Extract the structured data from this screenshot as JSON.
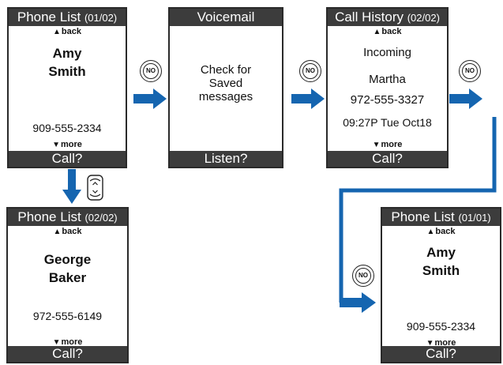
{
  "screens": {
    "phone_list_1": {
      "title": "Phone List",
      "page": "(01/02)",
      "back": "back",
      "name_first": "Amy",
      "name_last": "Smith",
      "number": "909-555-2334",
      "more": "more",
      "softkey": "Call?"
    },
    "voicemail": {
      "title": "Voicemail",
      "line1": "Check for",
      "line2": "Saved",
      "line3": "messages",
      "softkey": "Listen?"
    },
    "call_history": {
      "title": "Call History",
      "page": "(02/02)",
      "back": "back",
      "direction": "Incoming",
      "caller": "Martha",
      "number": "972-555-3327",
      "time": "09:27P Tue Oct18",
      "more": "more",
      "softkey": "Call?"
    },
    "phone_list_2": {
      "title": "Phone List",
      "page": "(02/02)",
      "back": "back",
      "name_first": "George",
      "name_last": "Baker",
      "number": "972-555-6149",
      "more": "more",
      "softkey": "Call?"
    },
    "phone_list_3": {
      "title": "Phone List",
      "page": "(01/01)",
      "back": "back",
      "name_first": "Amy",
      "name_last": "Smith",
      "number": "909-555-2334",
      "more": "more",
      "softkey": "Call?"
    }
  },
  "buttons": {
    "no_label": "NO"
  },
  "colors": {
    "arrow": "#1565b0",
    "bar": "#3c3c3c"
  },
  "icons": {
    "scroll_key": "up-down-scroll-key-icon"
  }
}
